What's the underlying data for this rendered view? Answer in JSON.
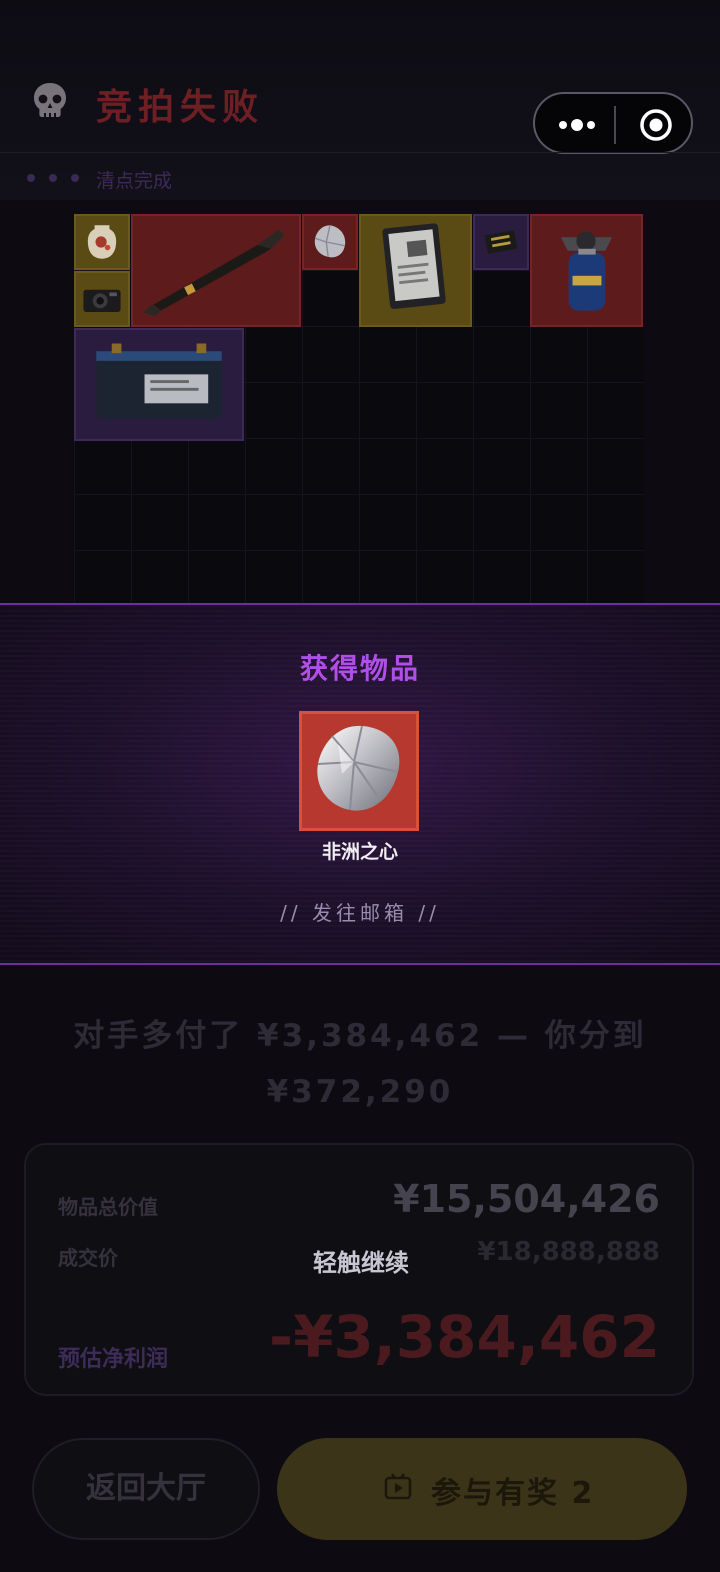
{
  "header": {
    "title": "竞拍失败",
    "status": "清点完成"
  },
  "icons": {
    "skull": "skull-icon",
    "more": "more-dots-icon",
    "close": "target-icon"
  },
  "grid_items": [
    {
      "name": "vase-item",
      "rarity": "yellow"
    },
    {
      "name": "camera-item",
      "rarity": "yellow"
    },
    {
      "name": "missile-item",
      "rarity": "red"
    },
    {
      "name": "diamond-item",
      "rarity": "red"
    },
    {
      "name": "document-item",
      "rarity": "yellow"
    },
    {
      "name": "circuit-board-item",
      "rarity": "purple"
    },
    {
      "name": "gas-stove-item",
      "rarity": "red"
    },
    {
      "name": "battery-item",
      "rarity": "purple"
    }
  ],
  "reward": {
    "title": "获得物品",
    "item_name": "非洲之心",
    "mail_link": "// 发往邮箱 //"
  },
  "message": {
    "line1": "对手多付了 ¥3,384,462 — 你分到",
    "line2": "¥372,290"
  },
  "summary": {
    "total_label": "物品总价值",
    "total_value": "¥15,504,426",
    "deal_label": "成交价",
    "deal_value": "¥18,888,888",
    "profit_label": "预估净利润",
    "profit_value": "-¥3,384,462",
    "tap_hint": "轻触继续"
  },
  "buttons": {
    "back_label": "返回大厅",
    "join_label": "参与有奖 2"
  },
  "colors": {
    "accent_purple": "#b04fe8",
    "rarity_red": "#b6382f",
    "rarity_yellow": "#5a4a14",
    "loss_red": "#4a1a1f"
  }
}
